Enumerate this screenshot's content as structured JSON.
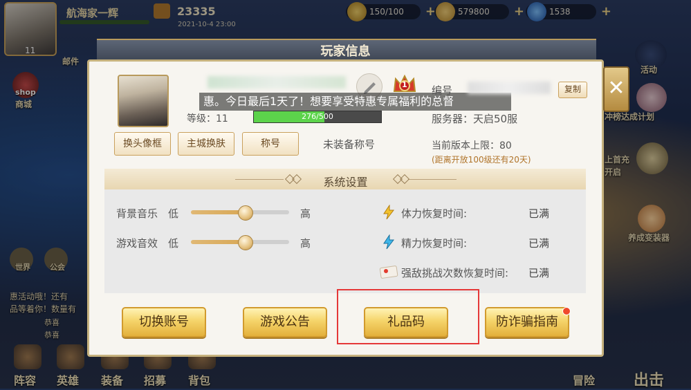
{
  "topbar": {
    "player_name": "航海家一辉",
    "avatar_level": "11",
    "power": "23335",
    "timestamp": "2021-10-4 23:00",
    "resources": [
      {
        "icon": "lightning-icon",
        "value": "150/100"
      },
      {
        "icon": "gold-coin-icon",
        "value": "579800"
      },
      {
        "icon": "diamond-icon",
        "value": "1538"
      }
    ]
  },
  "left_side": {
    "mail": "邮件",
    "shop": "商城",
    "shop_badge": "shop",
    "world": "世界",
    "guild": "公会",
    "chat_lines": [
      "惠活动哦！还有",
      "品等着你！数量有"
    ],
    "chat_tags": [
      "恭喜",
      "恭喜"
    ]
  },
  "right_side": {
    "activity": "活动",
    "ranking": "冲榜达成计划",
    "first_recharge": "上首充",
    "open": "开启",
    "equip": "养成变装器"
  },
  "bottom_nav": [
    "阵容",
    "英雄",
    "装备",
    "招募",
    "背包"
  ],
  "bottom_right": [
    "冒险",
    "出击"
  ],
  "dialog": {
    "title": "玩家信息",
    "banner": "惠。今日最后1天了！想要享受特惠专属福利的总督",
    "level_label": "等级：11",
    "exp_text": "276/500",
    "exp_ratio": 0.552,
    "vip_level": "1",
    "id_label": "编号",
    "copy_label": "复制",
    "server_label": "服务器：天启50服",
    "version_cap": "当前版本上限：80",
    "version_note": "(距离开放100级还有20天)",
    "buttons": {
      "avatar_frame": "换头像框",
      "city_skin": "主城换肤",
      "title": "称号"
    },
    "no_title": "未装备称号",
    "settings": {
      "title": "系统设置",
      "bgm_label": "背景音乐",
      "sfx_label": "游戏音效",
      "low": "低",
      "high": "高",
      "bgm_level": 0.55,
      "sfx_level": 0.55,
      "stamina_label": "体力恢复时间:",
      "stamina_value": "已满",
      "energy_label": "精力恢复时间:",
      "energy_value": "已满",
      "challenge_label": "强敌挑战次数恢复时间:",
      "challenge_value": "已满"
    },
    "actions": {
      "switch_account": "切换账号",
      "announcement": "游戏公告",
      "gift_code": "礼品码",
      "anti_fraud": "防诈骗指南"
    }
  },
  "colors": {
    "accent_gold": "#e3b03c",
    "highlight_red": "#e53838",
    "exp_green": "#5cd34b"
  }
}
